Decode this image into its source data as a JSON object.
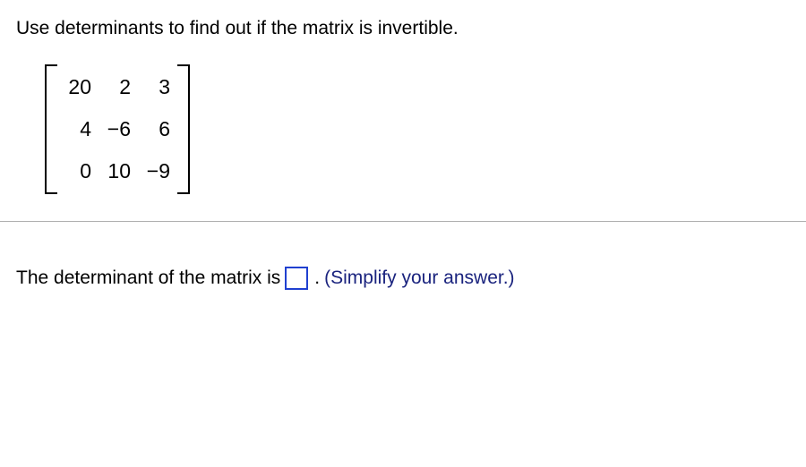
{
  "question": {
    "prompt": "Use determinants to find out if the matrix is invertible."
  },
  "matrix": {
    "rows": [
      [
        "20",
        "2",
        "3"
      ],
      [
        "4",
        "−6",
        "6"
      ],
      [
        "0",
        "10",
        "−9"
      ]
    ]
  },
  "answer": {
    "prefix": "The determinant of the matrix is",
    "period": ".",
    "hint": "(Simplify your answer.)"
  }
}
